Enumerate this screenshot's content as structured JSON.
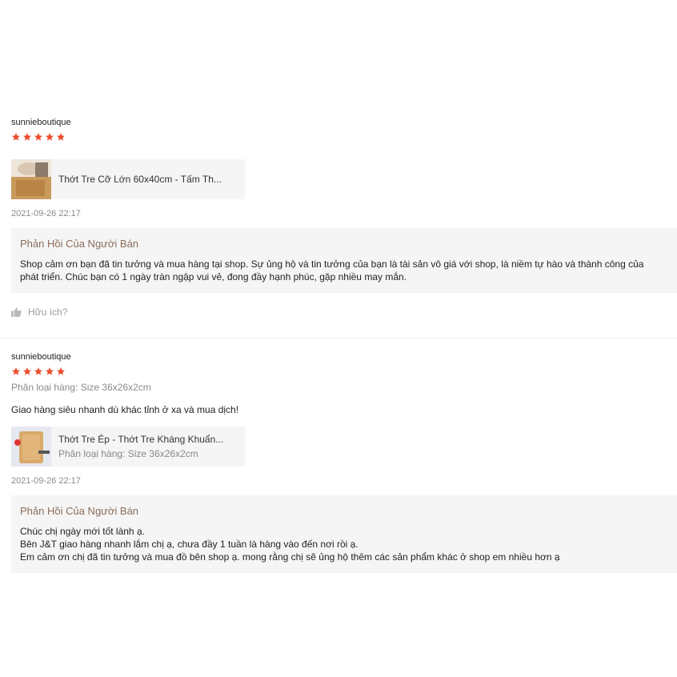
{
  "reviews": [
    {
      "username": "sunnieboutique",
      "rating": 5,
      "product_name": "Thớt Tre Cỡ Lớn 60x40cm - Tấm Th...",
      "timestamp": "2021-09-26 22:17",
      "reply_title": "Phản Hồi Của Người Bán",
      "reply_lines": [
        "Shop cảm ơn bạn đã tin tưởng và mua hàng tại shop. Sự ủng hộ và tin tưởng của bạn là tài sản vô giá với shop, là niềm tự hào và thành công của",
        "phát triển. Chúc bạn có 1 ngày tràn ngập vui vẻ, đong đầy hạnh phúc, gặp nhiều may mắn."
      ],
      "helpful_label": "Hữu ích?"
    },
    {
      "username": "sunnieboutique",
      "rating": 5,
      "variation": "Phân loại hàng: Size 36x26x2cm",
      "comment": "Giao hàng siêu nhanh dù khác tỉnh ở xa và mua dịch!",
      "product_name": "Thớt Tre Ép - Thớt Tre Kháng Khuẩn...",
      "product_variation": "Phân loại hàng: Size 36x26x2cm",
      "timestamp": "2021-09-26 22:17",
      "reply_title": "Phản Hồi Của Người Bán",
      "reply_lines": [
        "Chúc chị ngày mới tốt lành ạ.",
        "Bên J&T giao hàng nhanh lắm chị ạ, chưa đầy 1 tuần là hàng vào đến nơi rồi ạ.",
        "Em cảm ơn chị đã tin tưởng và mua đồ bên shop ạ. mong rằng chị sẽ ủng hộ thêm các sản phẩm khác ở shop em nhiều hơn ạ"
      ]
    }
  ],
  "colors": {
    "star": "#ee4d2d",
    "reply_title": "#8a6d5a",
    "panel": "#f5f5f5"
  },
  "icons": {
    "rating": "star-icon",
    "helpful": "thumbs-up-icon"
  }
}
